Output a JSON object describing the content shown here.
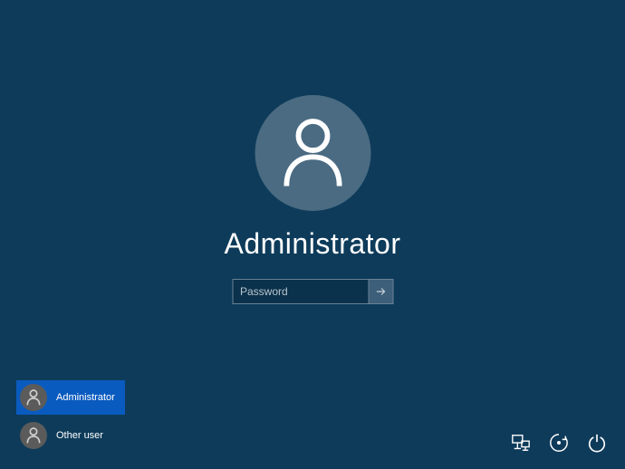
{
  "login": {
    "username": "Administrator",
    "password_placeholder": "Password",
    "password_value": ""
  },
  "users": [
    {
      "label": "Administrator",
      "selected": true
    },
    {
      "label": "Other user",
      "selected": false
    }
  ],
  "icons": {
    "network": "network-icon",
    "ease_of_access": "ease-of-access-icon",
    "power": "power-icon"
  },
  "colors": {
    "background": "#0e3b5a",
    "avatar_bg": "#4a6b82",
    "selected_tile": "#0a5bbf"
  }
}
